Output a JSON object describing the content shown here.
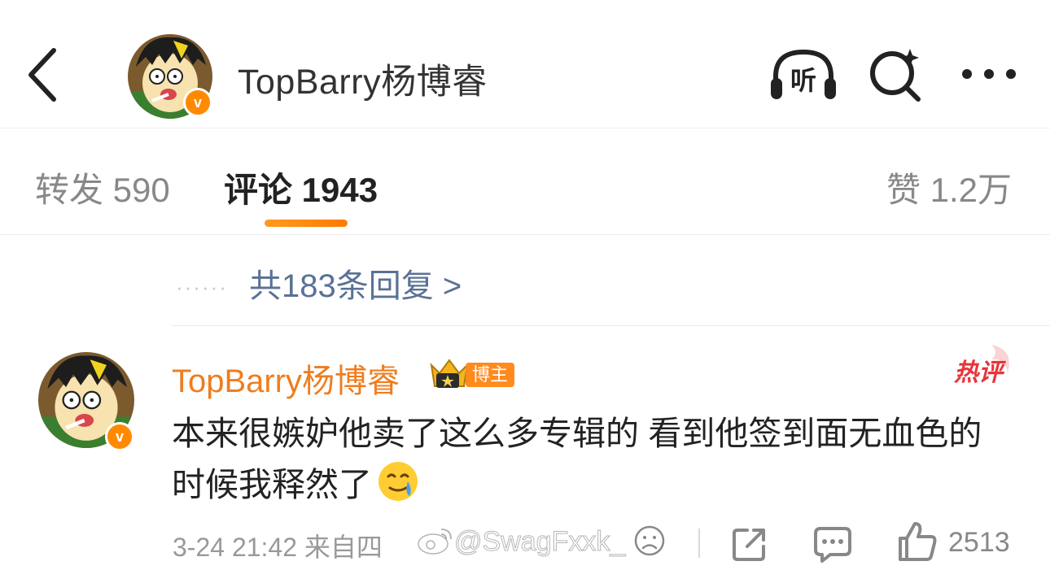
{
  "header": {
    "title": "TopBarry杨博睿",
    "listen_label": "听",
    "verified_mark": "v"
  },
  "tabs": {
    "repost": "转发 590",
    "comment": "评论 1943",
    "like": "赞 1.2万"
  },
  "replies": {
    "dots": "······",
    "link": "共183条回复 >"
  },
  "comment": {
    "author": "TopBarry杨博睿",
    "badge_host": "博主",
    "hot_label": "热评",
    "text": "本来很嫉妒他卖了这么多专辑的 看到他签到面无血色的时候我释然了",
    "emoji": "crying-smile-emoji",
    "time_source": "3-24 21:42 来自四",
    "like_count": "2513"
  },
  "watermark": {
    "text": "@SwagFxxk_",
    "logo": "weibo-logo-icon"
  },
  "colors": {
    "accent_orange": "#ff8a00",
    "author_orange": "#ef7d1f",
    "link_blue": "#5a7196",
    "hot_red": "#e8343a"
  }
}
